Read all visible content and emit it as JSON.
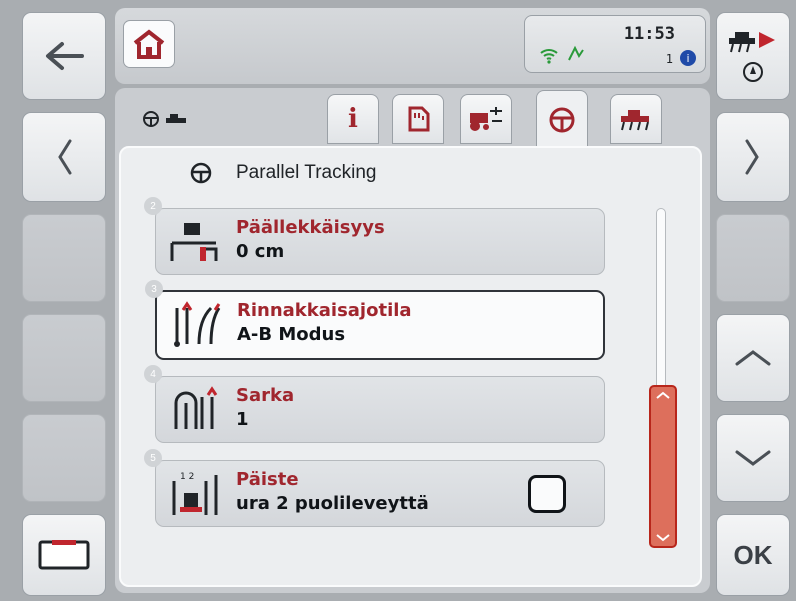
{
  "header": {
    "time": "11:53",
    "job_count": "1"
  },
  "tab_row": {
    "current_title_icon": "steering-wheel-icon",
    "tabs": [
      {
        "icon": "info-icon",
        "symbol": "i"
      },
      {
        "icon": "memory-card-icon"
      },
      {
        "icon": "tractor-settings-icon"
      },
      {
        "icon": "steering-wheel-icon",
        "active": true
      },
      {
        "icon": "implement-icon"
      }
    ]
  },
  "panel": {
    "title": "Parallel Tracking"
  },
  "items": [
    {
      "num": "2",
      "label": "Päällekkäisyys",
      "value": "0 cm",
      "icon": "overlap-icon"
    },
    {
      "num": "3",
      "label": "Rinnakkaisajotila",
      "value": "A-B Modus",
      "icon": "parallel-mode-icon",
      "selected": true
    },
    {
      "num": "4",
      "label": "Sarka",
      "value": "1",
      "icon": "tramline-icon"
    },
    {
      "num": "5",
      "label": "Päiste",
      "value": "ura 2 puolileveyttä",
      "icon": "headland-icon",
      "checkbox": false
    }
  ],
  "right_buttons": {
    "ok_label": "OK"
  },
  "colors": {
    "accent_red": "#a0262e",
    "scroll_thumb": "#dd6f5c"
  }
}
